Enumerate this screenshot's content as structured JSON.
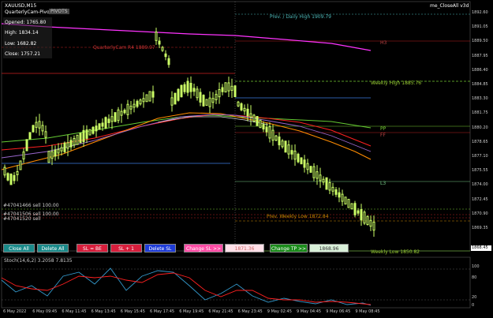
{
  "symbol_title": "XAUUSD,M15",
  "indicator_name": "QuarterlyCam-Pivots",
  "indicator_button": "PIVOTS",
  "ea_label": "me_CloseAll v3d",
  "info_panel": {
    "opened": "Opened: 1765.80",
    "high": "High: 1834.14",
    "low": "Low: 1682.82",
    "close": "Close: 1757.21"
  },
  "chart_labels": {
    "prev_daily_high": "Prev. / Daily High 1909.79",
    "quarterly_cam_r4": "QuarterlyCam R4  1889.97",
    "h3": "H3",
    "weekly_high": "Weekly High 1885.76",
    "pp": "PP",
    "ff": "FF",
    "l3": "L3",
    "prev_weekly_low": "Prev. Weekly Low 1872.84",
    "weekly_low": "Weekly Low 1850.82",
    "order_1": "#47041466 sell 100.00",
    "order_2": "#47041506 sell 100.00",
    "order_3": "#47041520 sell"
  },
  "buttons": {
    "close_all": "Close All",
    "delete_all": "Delete All",
    "sl_be": "SL = BE",
    "sl_plus": "SL + 1",
    "delete_sl": "Delete SL",
    "change_sl": "Change SL >>",
    "sl_value": "1871.36",
    "change_tp": "Change TP >>",
    "tp_value": "1868.96"
  },
  "price_axis": [
    "1892.60",
    "1891.05",
    "1889.50",
    "1887.95",
    "1886.40",
    "1884.85",
    "1883.30",
    "1881.75",
    "1880.20",
    "1878.65",
    "1877.10",
    "1875.55",
    "1874.00",
    "1872.45",
    "1870.90",
    "1869.35"
  ],
  "current_price": "1868.45",
  "stoch_label": "Stoch(14,6,2) 3.2058 7.8135",
  "stoch_axis": [
    "100",
    "80",
    "20",
    "0"
  ],
  "time_axis": [
    "6 May 2022",
    "6 May 09:45",
    "6 May 11:45",
    "6 May 13:45",
    "6 May 15:45",
    "6 May 17:45",
    "6 May 19:45",
    "6 May 21:45",
    "6 May 23:45",
    "9 May 02:45",
    "9 May 04:45",
    "9 May 06:45",
    "9 May 08:45"
  ],
  "colors": {
    "background": "#000000",
    "candle": "#ccff66",
    "magenta_ma": "#ff33ff",
    "orange_ma": "#ff8c00",
    "red_ma": "#ff2020",
    "green_ma": "#66cc33",
    "stoch_main": "#3399cc",
    "stoch_signal": "#ff2020"
  }
}
